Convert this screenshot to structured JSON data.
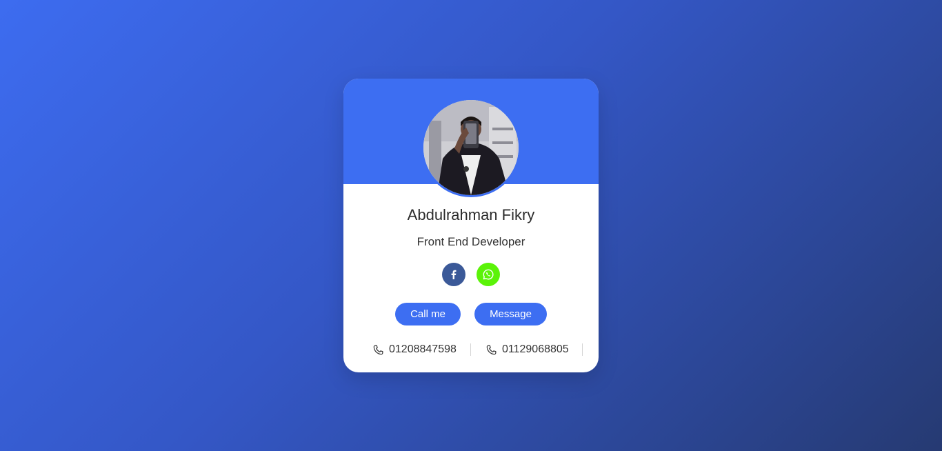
{
  "profile": {
    "name": "Abdulrahman Fikry",
    "role": "Front End Developer"
  },
  "social": {
    "facebook_icon": "facebook-icon",
    "whatsapp_icon": "whatsapp-icon"
  },
  "actions": {
    "call_label": "Call me",
    "message_label": "Message"
  },
  "phones": [
    {
      "number": "01208847598",
      "icon": "phone-icon"
    },
    {
      "number": "01129068805",
      "icon": "phone-icon"
    }
  ],
  "colors": {
    "accent": "#3d6ef2",
    "facebook": "#3b5998",
    "whatsapp": "#5bf308",
    "background_start": "#3d6cf0",
    "background_end": "#263a72"
  }
}
